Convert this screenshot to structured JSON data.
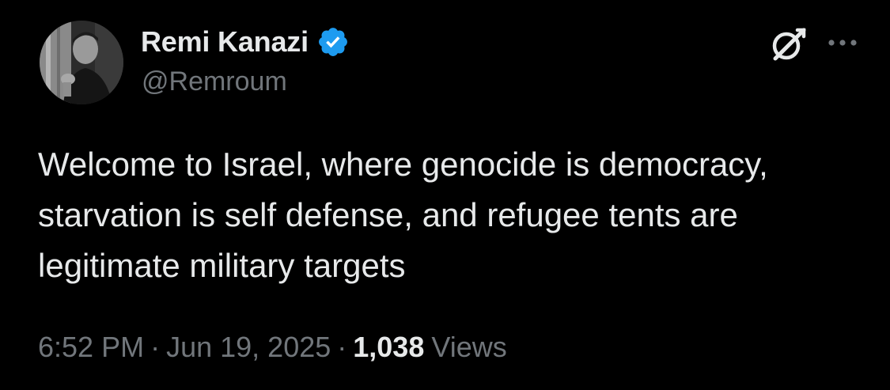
{
  "author": {
    "display_name": "Remi Kanazi",
    "handle": "@Remroum",
    "verified": true,
    "avatar_icon": "profile-photo",
    "verified_color": "#1d9bf0"
  },
  "header_actions": {
    "grok_icon": "grok-icon",
    "more_icon": "more-horizontal-icon"
  },
  "tweet": {
    "text_lines": [
      "Welcome to Israel, where genocide is democracy,",
      "starvation is self defense, and refugee tents are",
      "legitimate military targets"
    ]
  },
  "meta": {
    "time": "6:52 PM",
    "separator": "·",
    "date": "Jun 19, 2025",
    "views_count": "1,038",
    "views_label": "Views"
  },
  "colors": {
    "background": "#000000",
    "primary_text": "#e7e9ea",
    "secondary_text": "#71767b"
  }
}
